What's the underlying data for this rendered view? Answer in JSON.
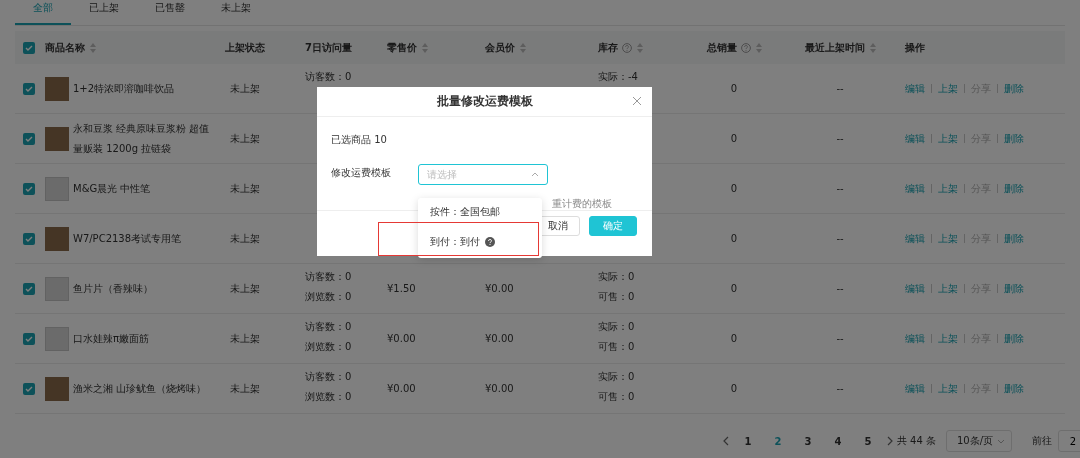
{
  "tabs": [
    {
      "label": "全部",
      "selected": true
    },
    {
      "label": "已上架",
      "selected": false
    },
    {
      "label": "已售罄",
      "selected": false
    },
    {
      "label": "未上架",
      "selected": false
    }
  ],
  "table": {
    "select_all": {
      "checked": true
    },
    "columns": [
      {
        "label": "商品名称",
        "sortable": true,
        "help": false
      },
      {
        "label": "上架状态",
        "sortable": false,
        "help": false
      },
      {
        "label": "7日访问量",
        "sortable": false,
        "help": false
      },
      {
        "label": "零售价",
        "sortable": true,
        "help": false
      },
      {
        "label": "会员价",
        "sortable": true,
        "help": false
      },
      {
        "label": "库存",
        "sortable": true,
        "help": true
      },
      {
        "label": "总销量",
        "sortable": true,
        "help": true
      },
      {
        "label": "最近上架时间",
        "sortable": true,
        "help": false
      },
      {
        "label": "操作",
        "sortable": false,
        "help": false
      }
    ],
    "rows": [
      {
        "checked": true,
        "photo": true,
        "name": "1+2特浓即溶咖啡饮品",
        "status": "未上架",
        "visits": [
          "访客数：0"
        ],
        "stock": [
          "实际：-4"
        ],
        "total": "0",
        "recent": "--",
        "actions": [
          {
            "label": "编辑",
            "disabled": false
          },
          {
            "label": "上架",
            "disabled": false
          },
          {
            "label": "分享",
            "disabled": true
          },
          {
            "label": "删除",
            "disabled": false
          }
        ]
      },
      {
        "checked": true,
        "photo": true,
        "name": "永和豆浆 经典原味豆浆粉 超值量贩装 1200g 拉链袋",
        "status": "未上架",
        "total": "0",
        "recent": "--",
        "actions": [
          {
            "label": "编辑",
            "disabled": false
          },
          {
            "label": "上架",
            "disabled": false
          },
          {
            "label": "分享",
            "disabled": true
          },
          {
            "label": "删除",
            "disabled": false
          }
        ]
      },
      {
        "checked": true,
        "photo": false,
        "name": "M&G晨光 中性笔",
        "status": "未上架",
        "total": "0",
        "recent": "--",
        "actions": [
          {
            "label": "编辑",
            "disabled": false
          },
          {
            "label": "上架",
            "disabled": false
          },
          {
            "label": "分享",
            "disabled": true
          },
          {
            "label": "删除",
            "disabled": false
          }
        ]
      },
      {
        "checked": true,
        "photo": true,
        "name": "W7/PC2138考试专用笔",
        "status": "未上架",
        "total": "0",
        "recent": "--",
        "actions": [
          {
            "label": "编辑",
            "disabled": false
          },
          {
            "label": "上架",
            "disabled": false
          },
          {
            "label": "分享",
            "disabled": true
          },
          {
            "label": "删除",
            "disabled": false
          }
        ]
      },
      {
        "checked": true,
        "photo": false,
        "name": "鱼片片（香辣味）",
        "status": "未上架",
        "visits": [
          "访客数：0",
          "浏览数：0"
        ],
        "retail": "¥1.50",
        "member": "¥0.00",
        "stock": [
          "实际：0",
          "可售：0"
        ],
        "total": "0",
        "recent": "--",
        "actions": [
          {
            "label": "编辑",
            "disabled": false
          },
          {
            "label": "上架",
            "disabled": false
          },
          {
            "label": "分享",
            "disabled": true
          },
          {
            "label": "删除",
            "disabled": false
          }
        ]
      },
      {
        "checked": true,
        "photo": false,
        "name": "口水娃辣π嫩面筋",
        "status": "未上架",
        "visits": [
          "访客数：0",
          "浏览数：0"
        ],
        "retail": "¥0.00",
        "member": "¥0.00",
        "stock": [
          "实际：0",
          "可售：0"
        ],
        "total": "0",
        "recent": "--",
        "actions": [
          {
            "label": "编辑",
            "disabled": false
          },
          {
            "label": "上架",
            "disabled": false
          },
          {
            "label": "分享",
            "disabled": true
          },
          {
            "label": "删除",
            "disabled": false
          }
        ]
      },
      {
        "checked": true,
        "photo": true,
        "name": "渔米之湘 山珍鱿鱼（烧烤味）",
        "status": "未上架",
        "visits": [
          "访客数：0",
          "浏览数：0"
        ],
        "retail": "¥0.00",
        "member": "¥0.00",
        "stock": [
          "实际：0",
          "可售：0"
        ],
        "total": "0",
        "recent": "--",
        "actions": [
          {
            "label": "编辑",
            "disabled": false
          },
          {
            "label": "上架",
            "disabled": false
          },
          {
            "label": "分享",
            "disabled": true
          },
          {
            "label": "删除",
            "disabled": false
          }
        ]
      }
    ]
  },
  "pagination": {
    "pages": [
      {
        "label": "1",
        "selected": false
      },
      {
        "label": "2",
        "selected": true
      },
      {
        "label": "3",
        "selected": false
      },
      {
        "label": "4",
        "selected": false
      },
      {
        "label": "5",
        "selected": false
      }
    ],
    "total": "共 44 条",
    "page_size": "10条/页",
    "goto_label": "前往",
    "goto_value": "2"
  },
  "dialog": {
    "title": "批量修改运费模板",
    "selected_count": "已选商品 10",
    "field_label": "修改运费模板",
    "select": {
      "placeholder": "请选择",
      "expanded": true
    },
    "options": [
      {
        "label": "按件：全国包邮",
        "help": false
      },
      {
        "label": "到付：到付",
        "help": true
      }
    ],
    "hint": "重计费的模板",
    "buttons": [
      {
        "label": "取消",
        "primary": false
      },
      {
        "label": "确定",
        "primary": true
      }
    ],
    "highlight": true
  }
}
